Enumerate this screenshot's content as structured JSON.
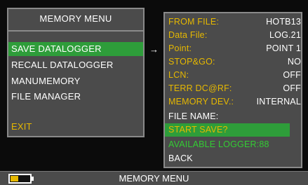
{
  "left_menu": {
    "title": "MEMORY MENU",
    "items": [
      {
        "label": "SAVE DATALOGGER",
        "selected": true
      },
      {
        "label": "RECALL DATALOGGER",
        "selected": false
      },
      {
        "label": "MANUMEMORY",
        "selected": false
      },
      {
        "label": "FILE MANAGER",
        "selected": false
      }
    ],
    "exit_label": "EXIT"
  },
  "arrow": "→",
  "right_panel": {
    "rows": [
      {
        "label": "FROM FILE:",
        "value": "HOTB13"
      },
      {
        "label": "Data File:",
        "value": "LOG.21"
      },
      {
        "label": "Point:",
        "value": "POINT 1"
      },
      {
        "label": "STOP&GO:",
        "value": "NO"
      },
      {
        "label": "LCN:",
        "value": "OFF"
      },
      {
        "label": "TERR DC@RF:",
        "value": "OFF"
      },
      {
        "label": "MEMORY DEV.:",
        "value": "INTERNAL"
      }
    ],
    "file_name_label": "FILE NAME:",
    "start_save_label": "START SAVE?",
    "available_logger_label": "AVAILABLE LOGGER:88",
    "back_label": "BACK"
  },
  "status_bar": {
    "title": "MEMORY MENU",
    "battery_level": 0.4
  },
  "colors": {
    "panel_bg": "#4b4b4b",
    "selection_green": "#2e9d3a",
    "label_yellow": "#e6b800",
    "available_green": "#33cc33"
  }
}
